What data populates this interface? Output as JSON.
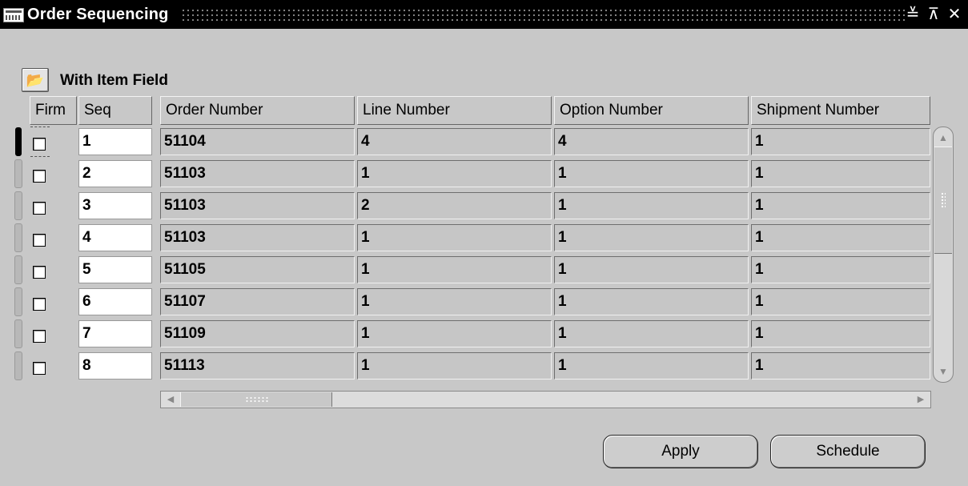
{
  "window": {
    "title": "Order Sequencing",
    "controls": {
      "minimize": "≚",
      "maximize": "⊼",
      "close": "✕"
    }
  },
  "block": {
    "title": "With Item Field",
    "toolbar_icon": "folder-open-icon"
  },
  "columns": [
    "Firm",
    "Seq",
    "Order Number",
    "Line Number",
    "Option Number",
    "Shipment Number"
  ],
  "rows": [
    {
      "firm": false,
      "seq": "1",
      "order": "51104",
      "line": "4",
      "option": "4",
      "shipment": "1"
    },
    {
      "firm": false,
      "seq": "2",
      "order": "51103",
      "line": "1",
      "option": "1",
      "shipment": "1"
    },
    {
      "firm": false,
      "seq": "3",
      "order": "51103",
      "line": "2",
      "option": "1",
      "shipment": "1"
    },
    {
      "firm": false,
      "seq": "4",
      "order": "51103",
      "line": "1",
      "option": "1",
      "shipment": "1"
    },
    {
      "firm": false,
      "seq": "5",
      "order": "51105",
      "line": "1",
      "option": "1",
      "shipment": "1"
    },
    {
      "firm": false,
      "seq": "6",
      "order": "51107",
      "line": "1",
      "option": "1",
      "shipment": "1"
    },
    {
      "firm": false,
      "seq": "7",
      "order": "51109",
      "line": "1",
      "option": "1",
      "shipment": "1"
    },
    {
      "firm": false,
      "seq": "8",
      "order": "51113",
      "line": "1",
      "option": "1",
      "shipment": "1"
    }
  ],
  "buttons": {
    "apply": "Apply",
    "schedule": "Schedule"
  }
}
